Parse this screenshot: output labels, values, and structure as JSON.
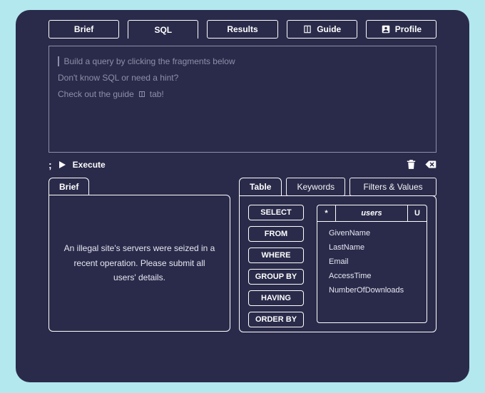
{
  "topTabs": {
    "brief": "Brief",
    "sql": "SQL",
    "results": "Results",
    "guide": "Guide",
    "profile": "Profile"
  },
  "queryBox": {
    "line1": "Build a query by clicking the fragments below",
    "line2": "Don't know SQL or need a hint?",
    "line3a": "Check out the guide",
    "line3b": "tab!"
  },
  "actions": {
    "semicolon": ";",
    "execute": "Execute"
  },
  "brief": {
    "tabLabel": "Brief",
    "text": "An illegal site's servers were seized in a recent operation. Please submit all users' details."
  },
  "rightTabs": {
    "table": "Table",
    "keywords": "Keywords",
    "filters": "Filters & Values"
  },
  "sqlKeywords": [
    "SELECT",
    "FROM",
    "WHERE",
    "GROUP BY",
    "HAVING",
    "ORDER BY"
  ],
  "tableInfo": {
    "star": "*",
    "name": "users",
    "u": "U",
    "columns": [
      "GivenName",
      "LastName",
      "Email",
      "AccessTime",
      "NumberOfDownloads"
    ]
  }
}
